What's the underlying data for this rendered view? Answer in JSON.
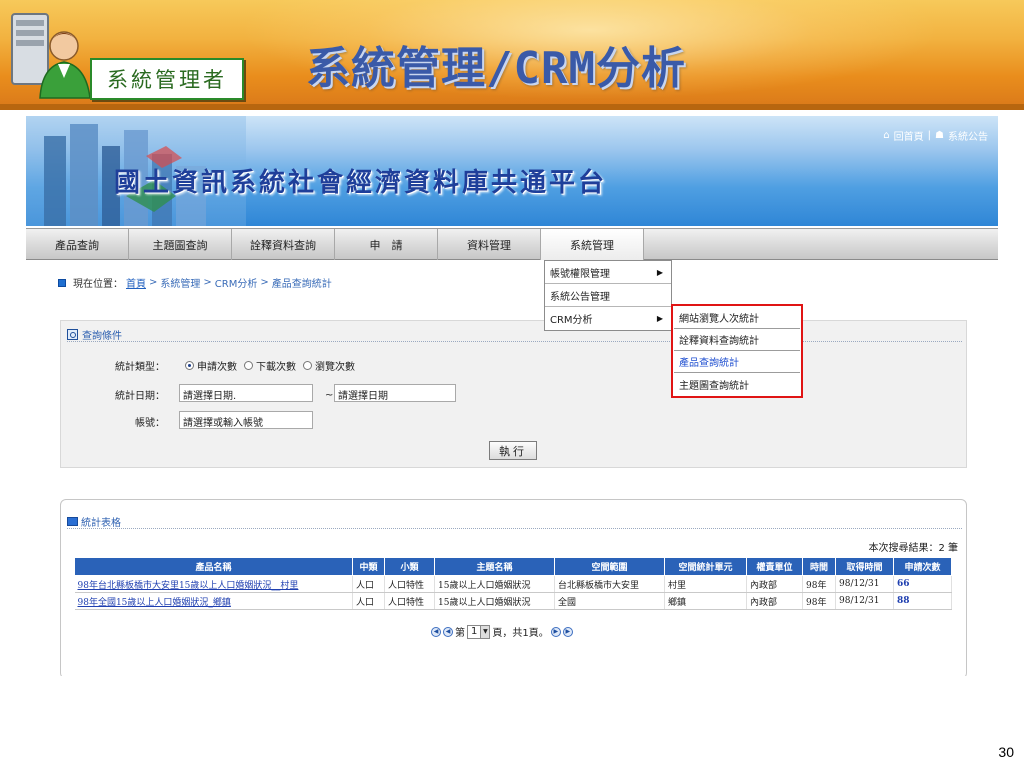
{
  "banner": {
    "role_badge": "系統管理者",
    "slide_title": "系統管理/CRM分析",
    "slide_number": "30"
  },
  "site": {
    "title": "國土資訊系統社會經濟資料庫共通平台",
    "home_link": "回首頁",
    "announce_link": "系統公告",
    "separator": "|"
  },
  "nav": {
    "items": [
      {
        "label": "產品查詢"
      },
      {
        "label": "主題圖查詢"
      },
      {
        "label": "詮釋資料查詢"
      },
      {
        "label": "申　請"
      },
      {
        "label": "資料管理"
      },
      {
        "label": "系統管理"
      }
    ]
  },
  "breadcrumb": {
    "prefix": "現在位置：",
    "home": "首頁",
    "sep": ">",
    "parts": [
      "系統管理",
      "CRM分析",
      "產品查詢統計"
    ]
  },
  "dropdown_level1": {
    "items": [
      {
        "label": "帳號權限管理",
        "arrow": "▶"
      },
      {
        "label": "系統公告管理",
        "arrow": ""
      },
      {
        "label": "CRM分析",
        "arrow": "▶"
      }
    ]
  },
  "dropdown_level2": {
    "items": [
      {
        "label": "網站瀏覽人次統計"
      },
      {
        "label": "詮釋資料查詢統計"
      },
      {
        "label": "產品查詢統計"
      },
      {
        "label": "主題圖查詢統計"
      }
    ]
  },
  "query": {
    "panel_title": "查詢條件",
    "type_label": "統計類型：",
    "options": [
      "申請次數",
      "下載次數",
      "瀏覽次數"
    ],
    "selected_option": "申請次數",
    "date_label": "統計日期：",
    "date_from": "請選擇日期.",
    "date_to": "請選擇日期",
    "tilde": "~",
    "account_label": "帳號：",
    "account_value": "請選擇或輸入帳號",
    "exec_label": "執行"
  },
  "results": {
    "panel_title": "統計表格",
    "count_text": "本次搜尋結果：2 筆",
    "columns": [
      "產品名稱",
      "中類",
      "小類",
      "主題名稱",
      "空間範圍",
      "空間統計單元",
      "權責單位",
      "時間",
      "取得時間",
      "申請次數"
    ],
    "rows": [
      [
        "98年台北縣板橋市大安里15歲以上人口婚姻狀況__村里",
        "人口",
        "人口特性",
        "15歲以上人口婚姻狀況",
        "台北縣板橋市大安里",
        "村里",
        "內政部",
        "98年",
        "98/12/31",
        "66"
      ],
      [
        "98年全國15歲以上人口婚姻狀況_鄉鎮",
        "人口",
        "人口特性",
        "15歲以上人口婚姻狀況",
        "全國",
        "鄉鎮",
        "內政部",
        "98年",
        "98/12/31",
        "88"
      ]
    ],
    "pager": {
      "prefix": "第",
      "current_page": "1",
      "suffix": "頁，共1頁。"
    }
  }
}
